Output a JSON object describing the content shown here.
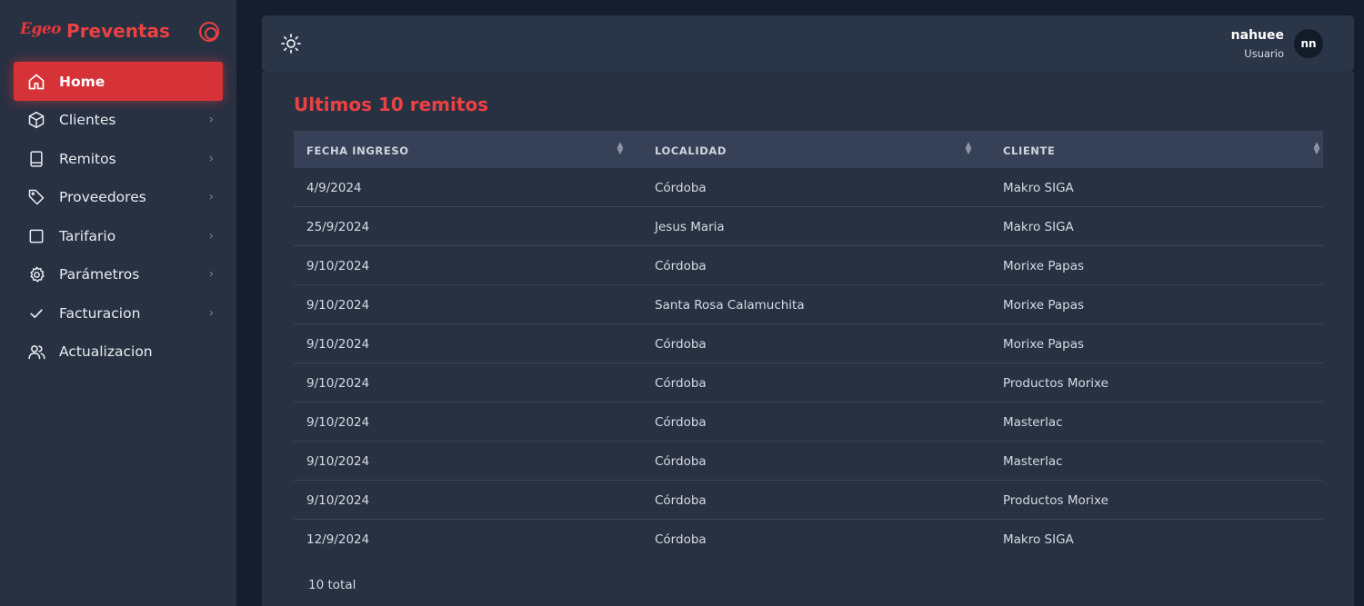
{
  "brand": {
    "logo_text": "Egeo",
    "title": "Preventas"
  },
  "sidebar": {
    "items": [
      {
        "label": "Home",
        "icon": "home-icon",
        "active": true,
        "has_chevron": false
      },
      {
        "label": "Clientes",
        "icon": "box-icon",
        "active": false,
        "has_chevron": true
      },
      {
        "label": "Remitos",
        "icon": "book-icon",
        "active": false,
        "has_chevron": true
      },
      {
        "label": "Proveedores",
        "icon": "tag-icon",
        "active": false,
        "has_chevron": true
      },
      {
        "label": "Tarifario",
        "icon": "square-icon",
        "active": false,
        "has_chevron": true
      },
      {
        "label": "Parámetros",
        "icon": "gear-icon",
        "active": false,
        "has_chevron": true
      },
      {
        "label": "Facturacion",
        "icon": "check-icon",
        "active": false,
        "has_chevron": true
      },
      {
        "label": "Actualizacion",
        "icon": "users-icon",
        "active": false,
        "has_chevron": false
      }
    ]
  },
  "topbar": {
    "theme_icon": "sun-icon",
    "user_name": "nahuee",
    "user_role": "Usuario",
    "avatar_initials": "nn"
  },
  "main": {
    "title": "Ultimos 10 remitos",
    "table": {
      "columns": [
        "FECHA INGRESO",
        "LOCALIDAD",
        "CLIENTE"
      ],
      "rows": [
        [
          "4/9/2024",
          "Córdoba",
          "Makro SIGA"
        ],
        [
          "25/9/2024",
          "Jesus Maria",
          "Makro SIGA"
        ],
        [
          "9/10/2024",
          "Córdoba",
          "Morixe Papas"
        ],
        [
          "9/10/2024",
          "Santa Rosa Calamuchita",
          "Morixe Papas"
        ],
        [
          "9/10/2024",
          "Córdoba",
          "Morixe Papas"
        ],
        [
          "9/10/2024",
          "Córdoba",
          "Productos Morixe"
        ],
        [
          "9/10/2024",
          "Córdoba",
          "Masterlac"
        ],
        [
          "9/10/2024",
          "Córdoba",
          "Masterlac"
        ],
        [
          "9/10/2024",
          "Córdoba",
          "Productos Morixe"
        ],
        [
          "12/9/2024",
          "Córdoba",
          "Makro SIGA"
        ]
      ]
    },
    "total_text": "10 total"
  },
  "colors": {
    "accent": "#ea4143",
    "sidebar_bg": "#283142",
    "page_bg": "#161d2c",
    "header_row_bg": "#364056"
  }
}
